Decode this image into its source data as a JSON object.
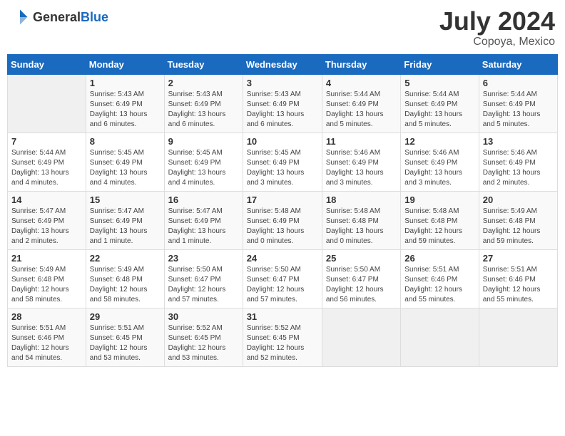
{
  "header": {
    "logo_general": "General",
    "logo_blue": "Blue",
    "title": "July 2024",
    "subtitle": "Copoya, Mexico"
  },
  "days_of_week": [
    "Sunday",
    "Monday",
    "Tuesday",
    "Wednesday",
    "Thursday",
    "Friday",
    "Saturday"
  ],
  "weeks": [
    [
      {
        "num": "",
        "info": ""
      },
      {
        "num": "1",
        "info": "Sunrise: 5:43 AM\nSunset: 6:49 PM\nDaylight: 13 hours\nand 6 minutes."
      },
      {
        "num": "2",
        "info": "Sunrise: 5:43 AM\nSunset: 6:49 PM\nDaylight: 13 hours\nand 6 minutes."
      },
      {
        "num": "3",
        "info": "Sunrise: 5:43 AM\nSunset: 6:49 PM\nDaylight: 13 hours\nand 6 minutes."
      },
      {
        "num": "4",
        "info": "Sunrise: 5:44 AM\nSunset: 6:49 PM\nDaylight: 13 hours\nand 5 minutes."
      },
      {
        "num": "5",
        "info": "Sunrise: 5:44 AM\nSunset: 6:49 PM\nDaylight: 13 hours\nand 5 minutes."
      },
      {
        "num": "6",
        "info": "Sunrise: 5:44 AM\nSunset: 6:49 PM\nDaylight: 13 hours\nand 5 minutes."
      }
    ],
    [
      {
        "num": "7",
        "info": "Sunrise: 5:44 AM\nSunset: 6:49 PM\nDaylight: 13 hours\nand 4 minutes."
      },
      {
        "num": "8",
        "info": "Sunrise: 5:45 AM\nSunset: 6:49 PM\nDaylight: 13 hours\nand 4 minutes."
      },
      {
        "num": "9",
        "info": "Sunrise: 5:45 AM\nSunset: 6:49 PM\nDaylight: 13 hours\nand 4 minutes."
      },
      {
        "num": "10",
        "info": "Sunrise: 5:45 AM\nSunset: 6:49 PM\nDaylight: 13 hours\nand 3 minutes."
      },
      {
        "num": "11",
        "info": "Sunrise: 5:46 AM\nSunset: 6:49 PM\nDaylight: 13 hours\nand 3 minutes."
      },
      {
        "num": "12",
        "info": "Sunrise: 5:46 AM\nSunset: 6:49 PM\nDaylight: 13 hours\nand 3 minutes."
      },
      {
        "num": "13",
        "info": "Sunrise: 5:46 AM\nSunset: 6:49 PM\nDaylight: 13 hours\nand 2 minutes."
      }
    ],
    [
      {
        "num": "14",
        "info": "Sunrise: 5:47 AM\nSunset: 6:49 PM\nDaylight: 13 hours\nand 2 minutes."
      },
      {
        "num": "15",
        "info": "Sunrise: 5:47 AM\nSunset: 6:49 PM\nDaylight: 13 hours\nand 1 minute."
      },
      {
        "num": "16",
        "info": "Sunrise: 5:47 AM\nSunset: 6:49 PM\nDaylight: 13 hours\nand 1 minute."
      },
      {
        "num": "17",
        "info": "Sunrise: 5:48 AM\nSunset: 6:49 PM\nDaylight: 13 hours\nand 0 minutes."
      },
      {
        "num": "18",
        "info": "Sunrise: 5:48 AM\nSunset: 6:48 PM\nDaylight: 13 hours\nand 0 minutes."
      },
      {
        "num": "19",
        "info": "Sunrise: 5:48 AM\nSunset: 6:48 PM\nDaylight: 12 hours\nand 59 minutes."
      },
      {
        "num": "20",
        "info": "Sunrise: 5:49 AM\nSunset: 6:48 PM\nDaylight: 12 hours\nand 59 minutes."
      }
    ],
    [
      {
        "num": "21",
        "info": "Sunrise: 5:49 AM\nSunset: 6:48 PM\nDaylight: 12 hours\nand 58 minutes."
      },
      {
        "num": "22",
        "info": "Sunrise: 5:49 AM\nSunset: 6:48 PM\nDaylight: 12 hours\nand 58 minutes."
      },
      {
        "num": "23",
        "info": "Sunrise: 5:50 AM\nSunset: 6:47 PM\nDaylight: 12 hours\nand 57 minutes."
      },
      {
        "num": "24",
        "info": "Sunrise: 5:50 AM\nSunset: 6:47 PM\nDaylight: 12 hours\nand 57 minutes."
      },
      {
        "num": "25",
        "info": "Sunrise: 5:50 AM\nSunset: 6:47 PM\nDaylight: 12 hours\nand 56 minutes."
      },
      {
        "num": "26",
        "info": "Sunrise: 5:51 AM\nSunset: 6:46 PM\nDaylight: 12 hours\nand 55 minutes."
      },
      {
        "num": "27",
        "info": "Sunrise: 5:51 AM\nSunset: 6:46 PM\nDaylight: 12 hours\nand 55 minutes."
      }
    ],
    [
      {
        "num": "28",
        "info": "Sunrise: 5:51 AM\nSunset: 6:46 PM\nDaylight: 12 hours\nand 54 minutes."
      },
      {
        "num": "29",
        "info": "Sunrise: 5:51 AM\nSunset: 6:45 PM\nDaylight: 12 hours\nand 53 minutes."
      },
      {
        "num": "30",
        "info": "Sunrise: 5:52 AM\nSunset: 6:45 PM\nDaylight: 12 hours\nand 53 minutes."
      },
      {
        "num": "31",
        "info": "Sunrise: 5:52 AM\nSunset: 6:45 PM\nDaylight: 12 hours\nand 52 minutes."
      },
      {
        "num": "",
        "info": ""
      },
      {
        "num": "",
        "info": ""
      },
      {
        "num": "",
        "info": ""
      }
    ]
  ]
}
